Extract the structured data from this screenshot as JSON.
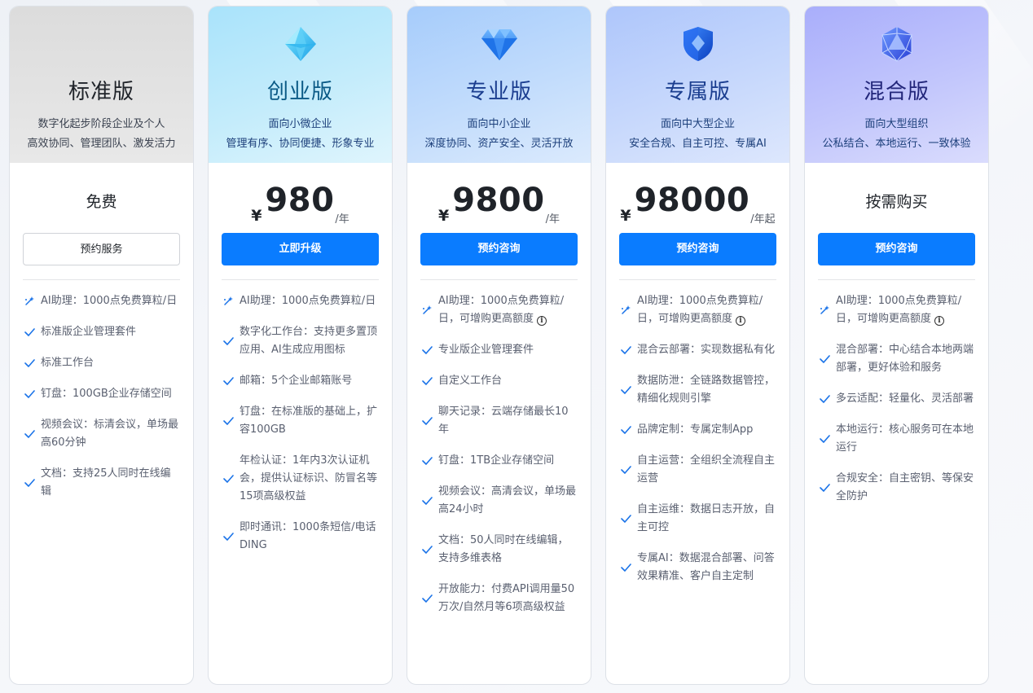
{
  "colors": {
    "primary": "#0a7cff",
    "check": "#1a73e8"
  },
  "plans": [
    {
      "name": "标准版",
      "subtitle1": "数字化起步阶段企业及个人",
      "subtitle2": "高效协同、管理团队、激发活力",
      "price_text": "免费",
      "cta": "预约服务",
      "features": [
        {
          "icon": "sparkle-icon",
          "text": "AI助理：1000点免费算粒/日"
        },
        {
          "icon": "check-icon",
          "text": "标准版企业管理套件"
        },
        {
          "icon": "check-icon",
          "text": "标准工作台"
        },
        {
          "icon": "check-icon",
          "text": "钉盘：100GB企业存储空间"
        },
        {
          "icon": "check-icon",
          "text": "视频会议：标清会议，单场最高60分钟"
        },
        {
          "icon": "check-icon",
          "text": "文档：支持25人同时在线编辑"
        }
      ]
    },
    {
      "name": "创业版",
      "subtitle1": "面向小微企业",
      "subtitle2": "管理有序、协同便捷、形象专业",
      "currency": "¥",
      "amount": "980",
      "unit": "/年",
      "cta": "立即升级",
      "features": [
        {
          "icon": "sparkle-icon",
          "text": "AI助理：1000点免费算粒/日"
        },
        {
          "icon": "check-icon",
          "text": "数字化工作台：支持更多置顶应用、AI生成应用图标"
        },
        {
          "icon": "check-icon",
          "text": "邮箱：5个企业邮箱账号"
        },
        {
          "icon": "check-icon",
          "text": "钉盘：在标准版的基础上，扩容100GB"
        },
        {
          "icon": "check-icon",
          "text": "年检认证：1年内3次认证机会，提供认证标识、防冒名等15项高级权益"
        },
        {
          "icon": "check-icon",
          "text": "即时通讯：1000条短信/电话DING"
        }
      ]
    },
    {
      "name": "专业版",
      "subtitle1": "面向中小企业",
      "subtitle2": "深度协同、资产安全、灵活开放",
      "currency": "¥",
      "amount": "9800",
      "unit": "/年",
      "cta": "预约咨询",
      "features": [
        {
          "icon": "sparkle-icon",
          "text": "AI助理：1000点免费算粒/日，可增购更高额度",
          "info": true
        },
        {
          "icon": "check-icon",
          "text": "专业版企业管理套件"
        },
        {
          "icon": "check-icon",
          "text": "自定义工作台"
        },
        {
          "icon": "check-icon",
          "text": "聊天记录：云端存储最长10年"
        },
        {
          "icon": "check-icon",
          "text": "钉盘：1TB企业存储空间"
        },
        {
          "icon": "check-icon",
          "text": "视频会议：高清会议，单场最高24小时"
        },
        {
          "icon": "check-icon",
          "text": "文档：50人同时在线编辑，支持多维表格"
        },
        {
          "icon": "check-icon",
          "text": "开放能力：付费API调用量50万次/自然月等6项高级权益"
        }
      ]
    },
    {
      "name": "专属版",
      "subtitle1": "面向中大型企业",
      "subtitle2": "安全合规、自主可控、专属AI",
      "currency": "¥",
      "amount": "98000",
      "unit": "/年起",
      "cta": "预约咨询",
      "features": [
        {
          "icon": "sparkle-icon",
          "text": "AI助理：1000点免费算粒/日，可增购更高额度",
          "info": true
        },
        {
          "icon": "check-icon",
          "text": "混合云部署：实现数据私有化"
        },
        {
          "icon": "check-icon",
          "text": "数据防泄：全链路数据管控，精细化规则引擎"
        },
        {
          "icon": "check-icon",
          "text": "品牌定制：专属定制App"
        },
        {
          "icon": "check-icon",
          "text": "自主运营：全组织全流程自主运营"
        },
        {
          "icon": "check-icon",
          "text": "自主运维：数据日志开放，自主可控"
        },
        {
          "icon": "check-icon",
          "text": "专属AI：数据混合部署、问答效果精准、客户自主定制"
        }
      ]
    },
    {
      "name": "混合版",
      "subtitle1": "面向大型组织",
      "subtitle2": "公私结合、本地运行、一致体验",
      "price_text": "按需购买",
      "cta": "预约咨询",
      "features": [
        {
          "icon": "sparkle-icon",
          "text": "AI助理：1000点免费算粒/日，可增购更高额度",
          "info": true
        },
        {
          "icon": "check-icon",
          "text": "混合部署：中心结合本地两端部署，更好体验和服务"
        },
        {
          "icon": "check-icon",
          "text": "多云适配：轻量化、灵活部署"
        },
        {
          "icon": "check-icon",
          "text": "本地运行：核心服务可在本地运行"
        },
        {
          "icon": "check-icon",
          "text": "合规安全：自主密钥、等保安全防护"
        }
      ]
    }
  ]
}
